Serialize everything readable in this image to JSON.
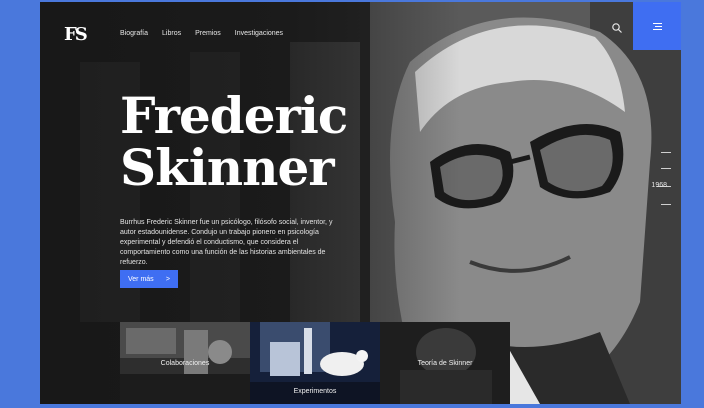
{
  "header": {
    "logo": "FS",
    "nav": [
      "Biografía",
      "Libros",
      "Premios",
      "Investigaciones"
    ]
  },
  "icons": {
    "search": "search-icon",
    "menu": "hamburger-menu-icon"
  },
  "hero": {
    "title_line1": "Frederic",
    "title_line2": "Skinner",
    "description": "Burrhus Frederic Skinner fue un psicólogo, filósofo social, inventor, y autor estadounidense. Condujo un trabajo pionero en psicología experimental y defendió el conductismo, que considera el comportamiento como una función de las historias ambientales de refuerzo.",
    "cta_label": "Ver más",
    "cta_arrow": ">"
  },
  "timeline": {
    "year": "1968"
  },
  "cards": [
    {
      "label": "Colaboraciones"
    },
    {
      "label": "Experimentos"
    },
    {
      "label": "Teoría de Skinner"
    }
  ],
  "colors": {
    "accent": "#3f6ef2",
    "page_background": "#4a78dc"
  }
}
